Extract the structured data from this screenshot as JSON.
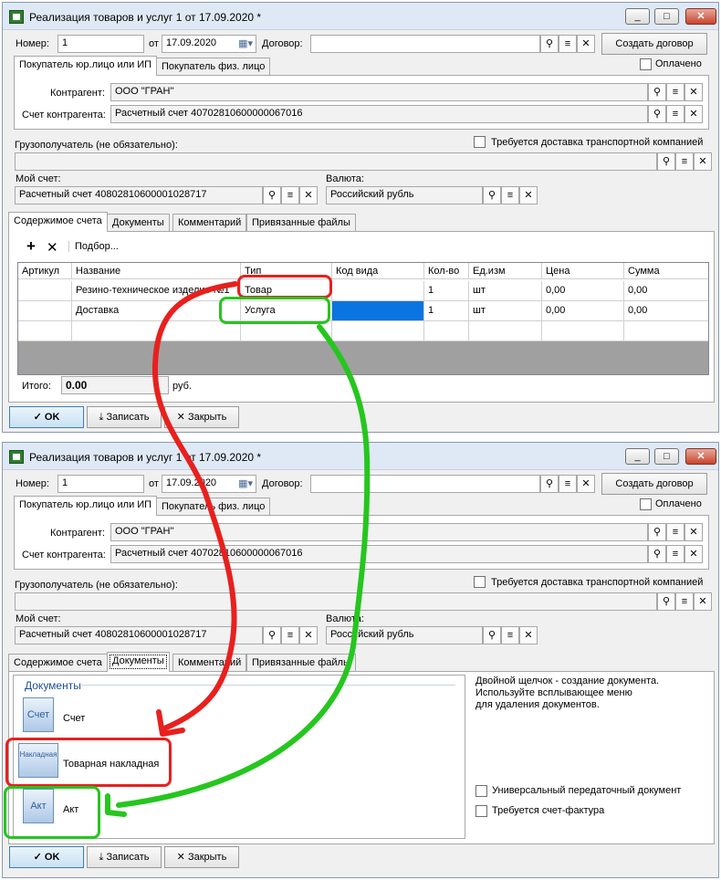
{
  "windows": [
    {
      "title": "Реализация товаров и услуг 1 от 17.09.2020 *",
      "number_label": "Номер:",
      "number": "1",
      "date_label": "от",
      "date": "17.09.2020",
      "contract_label": "Договор:",
      "contract": "",
      "create_contract": "Создать договор",
      "tab_legal": "Покупатель юр.лицо или ИП",
      "tab_person": "Покупатель физ. лицо",
      "paid_label": "Оплачено",
      "counterparty_label": "Контрагент:",
      "counterparty": "ООО \"ГРАН\"",
      "cp_account_label": "Счет контрагента:",
      "cp_account": "Расчетный счет 40702810600000067016",
      "consignee_label": "Грузополучатель (не обязательно):",
      "delivery_label": "Требуется доставка транспортной компанией",
      "my_account_label": "Мой счет:",
      "my_account": "Расчетный счет 40802810600001028717",
      "currency_label": "Валюта:",
      "currency": "Российский рубль",
      "tabs": [
        "Содержимое счета",
        "Документы",
        "Комментарий",
        "Привязанные файлы"
      ],
      "ok": "OK",
      "save": "Записать",
      "close": "Закрыть"
    }
  ],
  "items": {
    "add": "+",
    "delete": "✕",
    "pick": "Подбор...",
    "columns": [
      "Артикул",
      "Название",
      "Тип",
      "Код вида",
      "Кол-во",
      "Ед.изм",
      "Цена",
      "Сумма"
    ],
    "rows": [
      [
        "",
        "Резино-техническое изделие №1",
        "Товар",
        "",
        "1",
        "шт",
        "0,00",
        "0,00"
      ],
      [
        "",
        "Доставка",
        "Услуга",
        "",
        "1",
        "шт",
        "0,00",
        "0,00"
      ]
    ],
    "total_label": "Итого:",
    "total": "0.00",
    "currency_short": "руб."
  },
  "documents": {
    "header": "Документы",
    "items": [
      {
        "icon_text": "Счет",
        "label": "Счет"
      },
      {
        "icon_text": "Накладная",
        "label": "Товарная накладная"
      },
      {
        "icon_text": "Акт",
        "label": "Акт"
      }
    ],
    "hint": [
      "Двойной щелчок - создание документа.",
      "Используйте всплывающее меню",
      "для удаления документов."
    ],
    "upd_label": "Универсальный передаточный документ",
    "invoice_label": "Требуется счет-фактура"
  },
  "annotations": {
    "red": "#e8201e",
    "green": "#25c61e",
    "selected_cell": "#0a74e0"
  }
}
